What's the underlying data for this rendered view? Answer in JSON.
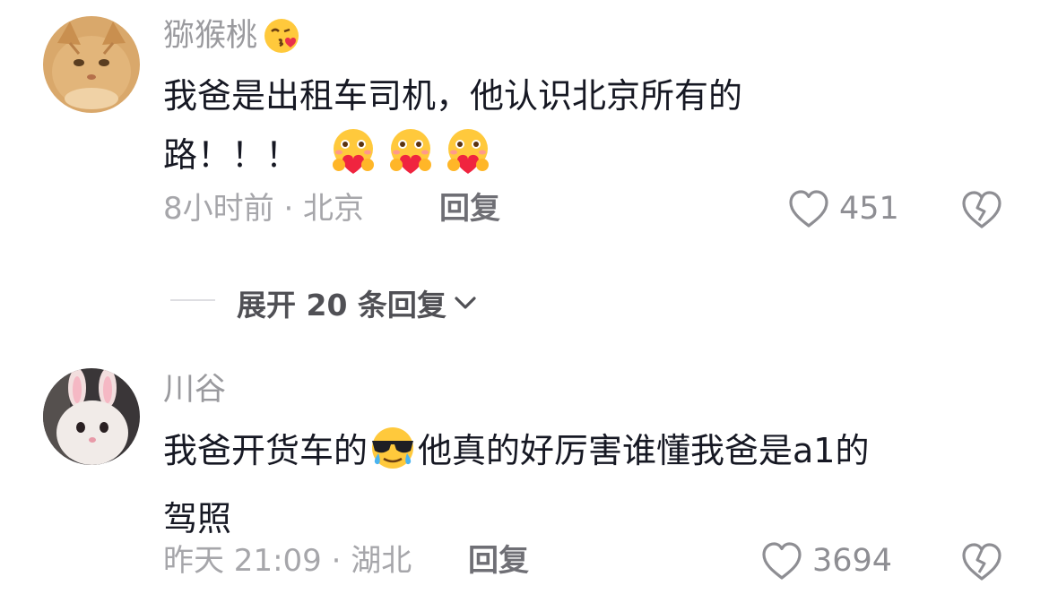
{
  "comments": [
    {
      "username": "猕猴桃",
      "username_emoji": "kiss-emoji",
      "text_line1": "我爸是出租车司机，他认识北京所有的",
      "text_line2": "路！！！",
      "text_emojis": [
        "hug-heart-emoji",
        "hug-heart-emoji",
        "hug-heart-emoji"
      ],
      "meta": "8小时前 · 北京",
      "reply_label": "回复",
      "likes": "451"
    },
    {
      "username": "川谷",
      "text_part1": "我爸开货车的",
      "text_emoji": "cool-sweat-emoji",
      "text_part2": "他真的好厉害谁懂我爸是a1的",
      "text_line2": "驾照",
      "meta": "昨天 21:09 · 湖北",
      "reply_label": "回复",
      "likes": "3694"
    }
  ],
  "expand_replies": {
    "label": "展开 20 条回复"
  },
  "colors": {
    "username": "#9a9a9e",
    "text": "#161823",
    "meta": "#a6a6aa",
    "reply": "#6f6f75"
  }
}
